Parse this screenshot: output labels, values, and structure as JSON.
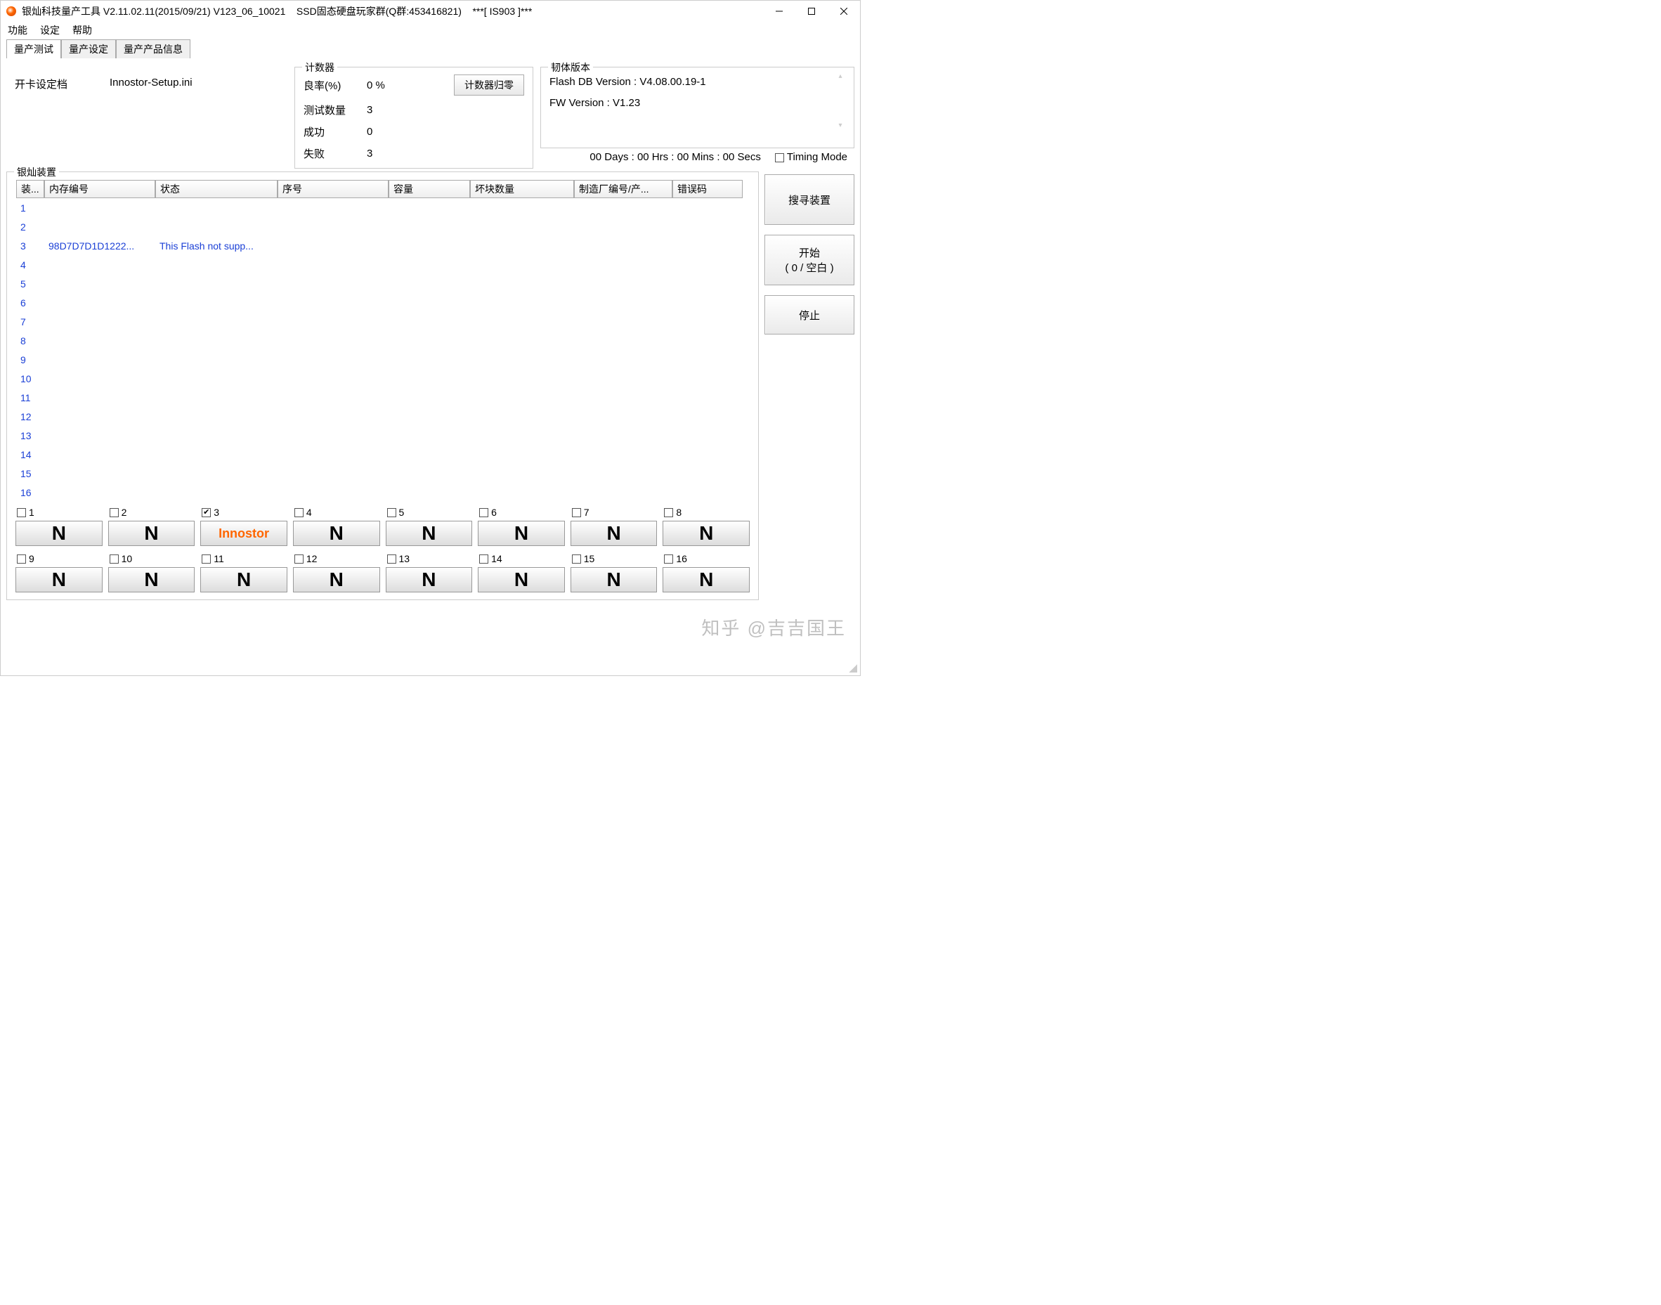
{
  "title": "银灿科技量产工具 V2.11.02.11(2015/09/21) V123_06_10021    SSD固态硬盘玩家群(Q群:453416821)    ***[ IS903 ]***",
  "menu": {
    "fn": "功能",
    "settings": "设定",
    "help": "帮助"
  },
  "tabs": {
    "t1": "量产测试",
    "t2": "量产设定",
    "t3": "量产产品信息"
  },
  "openCard": {
    "label": "开卡设定档",
    "value": "Innostor-Setup.ini"
  },
  "counter": {
    "legend": "计数器",
    "yield_label": "良率(%)",
    "yield_value": "0 %",
    "tested_label": "测试数量",
    "tested_value": "3",
    "pass_label": "成功",
    "pass_value": "0",
    "fail_label": "失败",
    "fail_value": "3",
    "reset": "计数器归零"
  },
  "fw": {
    "legend": "韧体版本",
    "line1": "Flash DB Version :  V4.08.00.19-1",
    "line2": "FW Version :    V1.23"
  },
  "elapsed": "00 Days : 00 Hrs : 00 Mins : 00 Secs",
  "timing_label": "Timing Mode",
  "devices_legend": "银灿装置",
  "columns": {
    "c0": "装...",
    "c1": "内存编号",
    "c2": "状态",
    "c3": "序号",
    "c4": "容量",
    "c5": "坏块数量",
    "c6": "制造厂编号/产...",
    "c7": "错误码"
  },
  "row3": {
    "mem": "98D7D7D1D1222...",
    "status": "This Flash not supp..."
  },
  "side": {
    "search": "搜寻装置",
    "start1": "开始",
    "start2": "( 0 / 空白 )",
    "stop": "停止"
  },
  "slots": [
    {
      "n": "1",
      "chk": false,
      "label": "N",
      "cls": ""
    },
    {
      "n": "2",
      "chk": false,
      "label": "N",
      "cls": ""
    },
    {
      "n": "3",
      "chk": true,
      "label": "Innostor",
      "cls": "innostor"
    },
    {
      "n": "4",
      "chk": false,
      "label": "N",
      "cls": ""
    },
    {
      "n": "5",
      "chk": false,
      "label": "N",
      "cls": ""
    },
    {
      "n": "6",
      "chk": false,
      "label": "N",
      "cls": ""
    },
    {
      "n": "7",
      "chk": false,
      "label": "N",
      "cls": ""
    },
    {
      "n": "8",
      "chk": false,
      "label": "N",
      "cls": ""
    },
    {
      "n": "9",
      "chk": false,
      "label": "N",
      "cls": ""
    },
    {
      "n": "10",
      "chk": false,
      "label": "N",
      "cls": ""
    },
    {
      "n": "11",
      "chk": false,
      "label": "N",
      "cls": ""
    },
    {
      "n": "12",
      "chk": false,
      "label": "N",
      "cls": ""
    },
    {
      "n": "13",
      "chk": false,
      "label": "N",
      "cls": ""
    },
    {
      "n": "14",
      "chk": false,
      "label": "N",
      "cls": ""
    },
    {
      "n": "15",
      "chk": false,
      "label": "N",
      "cls": ""
    },
    {
      "n": "16",
      "chk": false,
      "label": "N",
      "cls": ""
    }
  ],
  "watermark": "知乎 @吉吉国王"
}
